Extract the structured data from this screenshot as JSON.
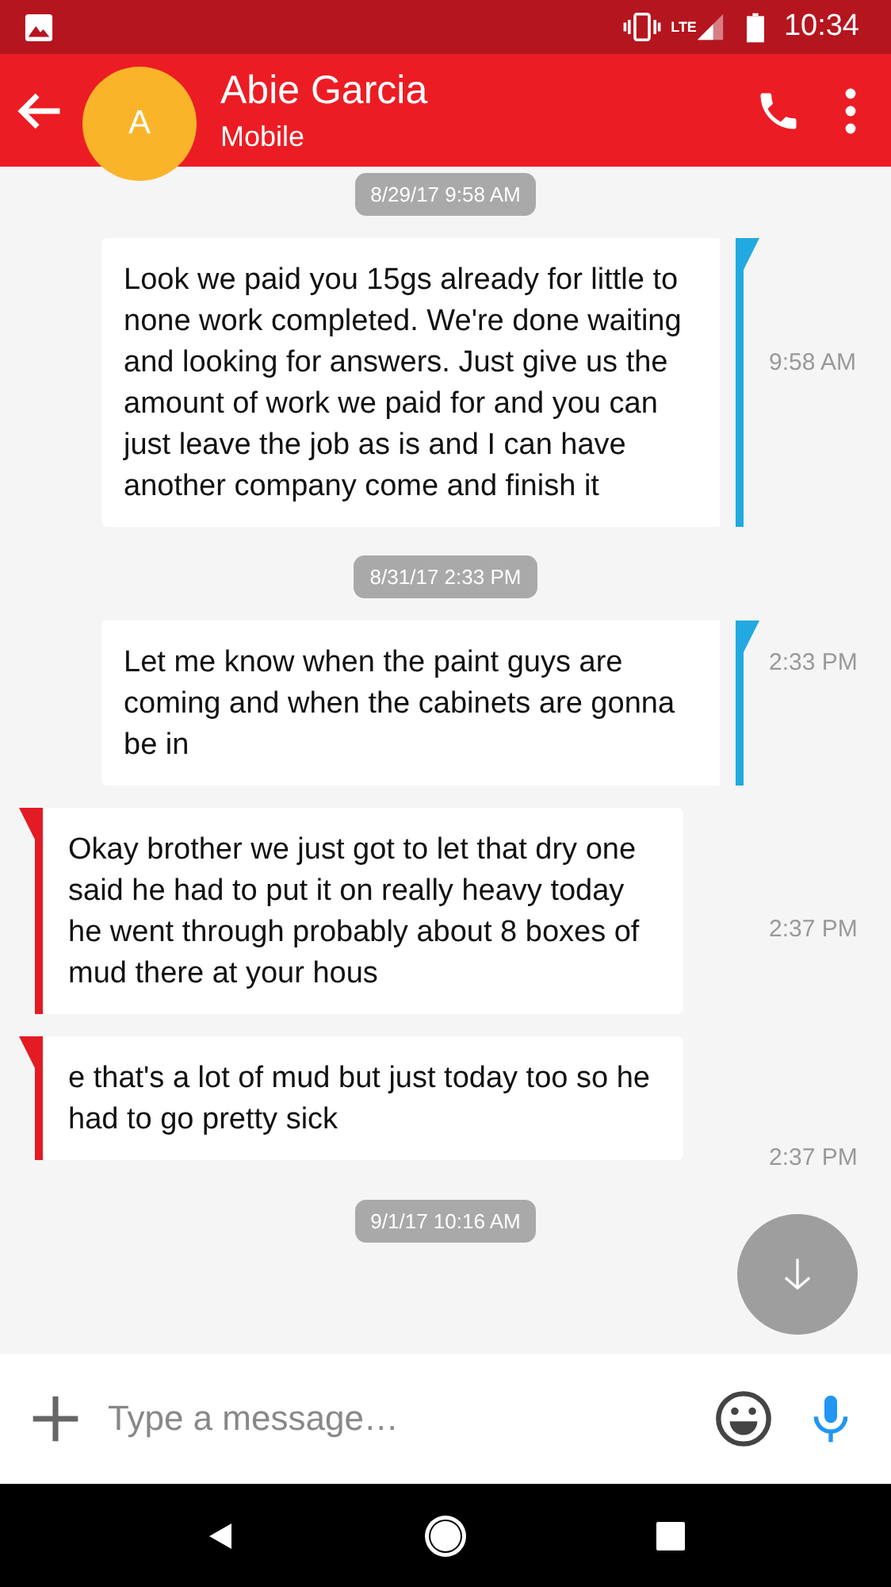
{
  "status_bar": {
    "time": "10:34",
    "network": "LTE"
  },
  "header": {
    "avatar_letter": "A",
    "name": "Abie Garcia",
    "subtitle": "Mobile"
  },
  "items": [
    {
      "kind": "date",
      "text": "8/29/17 9:58 AM"
    },
    {
      "kind": "sent",
      "text": "Look we paid you 15gs already for little to none work completed. We're done waiting and looking for answers. Just give us the amount of work we paid for and you can just leave the job as is and I can have another company come and finish it",
      "time": "9:58 AM"
    },
    {
      "kind": "date",
      "text": "8/31/17 2:33 PM"
    },
    {
      "kind": "sent",
      "text": "Let me know when the paint guys are coming and when the cabinets are gonna be in",
      "time": "2:33 PM"
    },
    {
      "kind": "received",
      "text": "Okay brother we just got to let that dry one said he had to put it on really heavy today he went through probably about 8 boxes of mud there at your hous",
      "time": "2:37 PM"
    },
    {
      "kind": "received",
      "text": "e that's a lot of mud but just today too so he had to go pretty sick",
      "time": "2:37 PM"
    },
    {
      "kind": "date",
      "text": "9/1/17 10:16 AM"
    }
  ],
  "composer": {
    "placeholder": "Type a message…"
  }
}
